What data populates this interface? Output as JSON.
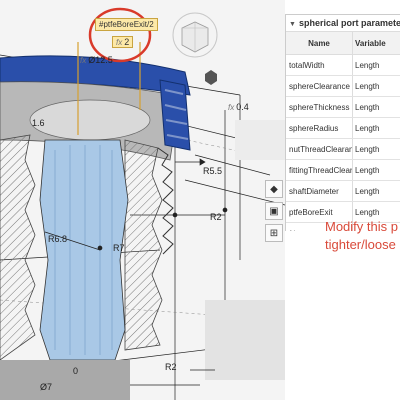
{
  "viewport": {
    "variable_tag": "#ptfeBoreExit/2",
    "variable_value": "2",
    "fx_symbol": "fx",
    "dimensions": {
      "d_top": "Ø12.5",
      "d_left": "1.6",
      "d_right_top": "0.4",
      "r_5": "R5.5",
      "r_2": "R2",
      "r_68": "R6.8",
      "r_7": "R7",
      "d_bottom": "Ø7",
      "r_bottom": "R2",
      "zero": "0"
    }
  },
  "panel": {
    "title": "spherical port parameters",
    "columns": [
      "Name",
      "Variable"
    ],
    "rows": [
      {
        "name": "totalWidth",
        "variable": "Length"
      },
      {
        "name": "sphereClearance",
        "variable": "Length"
      },
      {
        "name": "sphereThickness",
        "variable": "Length"
      },
      {
        "name": "sphereRadius",
        "variable": "Length"
      },
      {
        "name": "nutThreadClearance",
        "variable": "Length"
      },
      {
        "name": "fittingThreadClearance",
        "variable": "Length"
      },
      {
        "name": "shaftDiameter",
        "variable": "Length"
      },
      {
        "name": "ptfeBoreExit",
        "variable": "Length"
      }
    ],
    "placeholder": "Name"
  },
  "note": {
    "line1": "Modify this p",
    "line2": "tighter/loose"
  },
  "colors": {
    "accent_blue": "#2a4faa",
    "part_blue": "#a9c8e6",
    "annotation_red": "#d94a3a"
  }
}
